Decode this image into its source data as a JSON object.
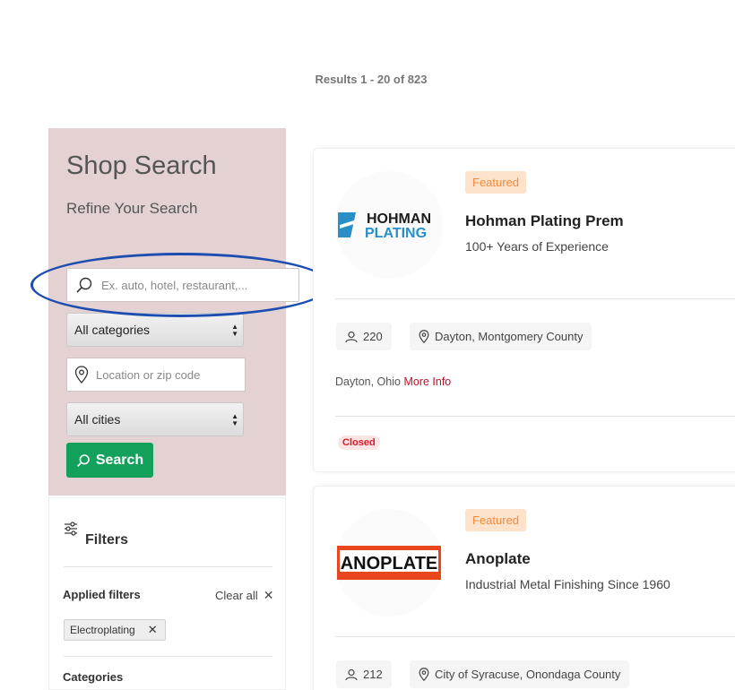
{
  "results": {
    "text": "Results 1 - 20 of 823"
  },
  "search_panel": {
    "title": "Shop Search",
    "subtitle": "Refine Your Search",
    "keyword_placeholder": "Ex. auto, hotel, restaurant,...",
    "category_select": "All categories",
    "location_placeholder": "Location or zip code",
    "city_select": "All cities",
    "search_button": "Search",
    "highlight_color": "#1d4db0",
    "panel_color": "#e4d2d2",
    "button_color": "#12a05a"
  },
  "filters": {
    "title": "Filters",
    "applied_label": "Applied filters",
    "clear_all": "Clear all",
    "chips": [
      "Electroplating"
    ],
    "categories_label": "Categories"
  },
  "listings": [
    {
      "badge": "Featured",
      "logo_text_1": "HOHMAN",
      "logo_text_2": "PLATING",
      "title": "Hohman Plating Prem",
      "tagline": "100+ Years of Experience",
      "count": "220",
      "location_pill": "Dayton, Montgomery County",
      "location_text": "Dayton, Ohio",
      "more_info": "More Info",
      "status": "Closed"
    },
    {
      "badge": "Featured",
      "logo_text_1": "ANOPLATE",
      "title": "Anoplate",
      "tagline": "Industrial Metal Finishing Since 1960",
      "count": "212",
      "location_pill": "City of Syracuse, Onondaga County"
    }
  ]
}
